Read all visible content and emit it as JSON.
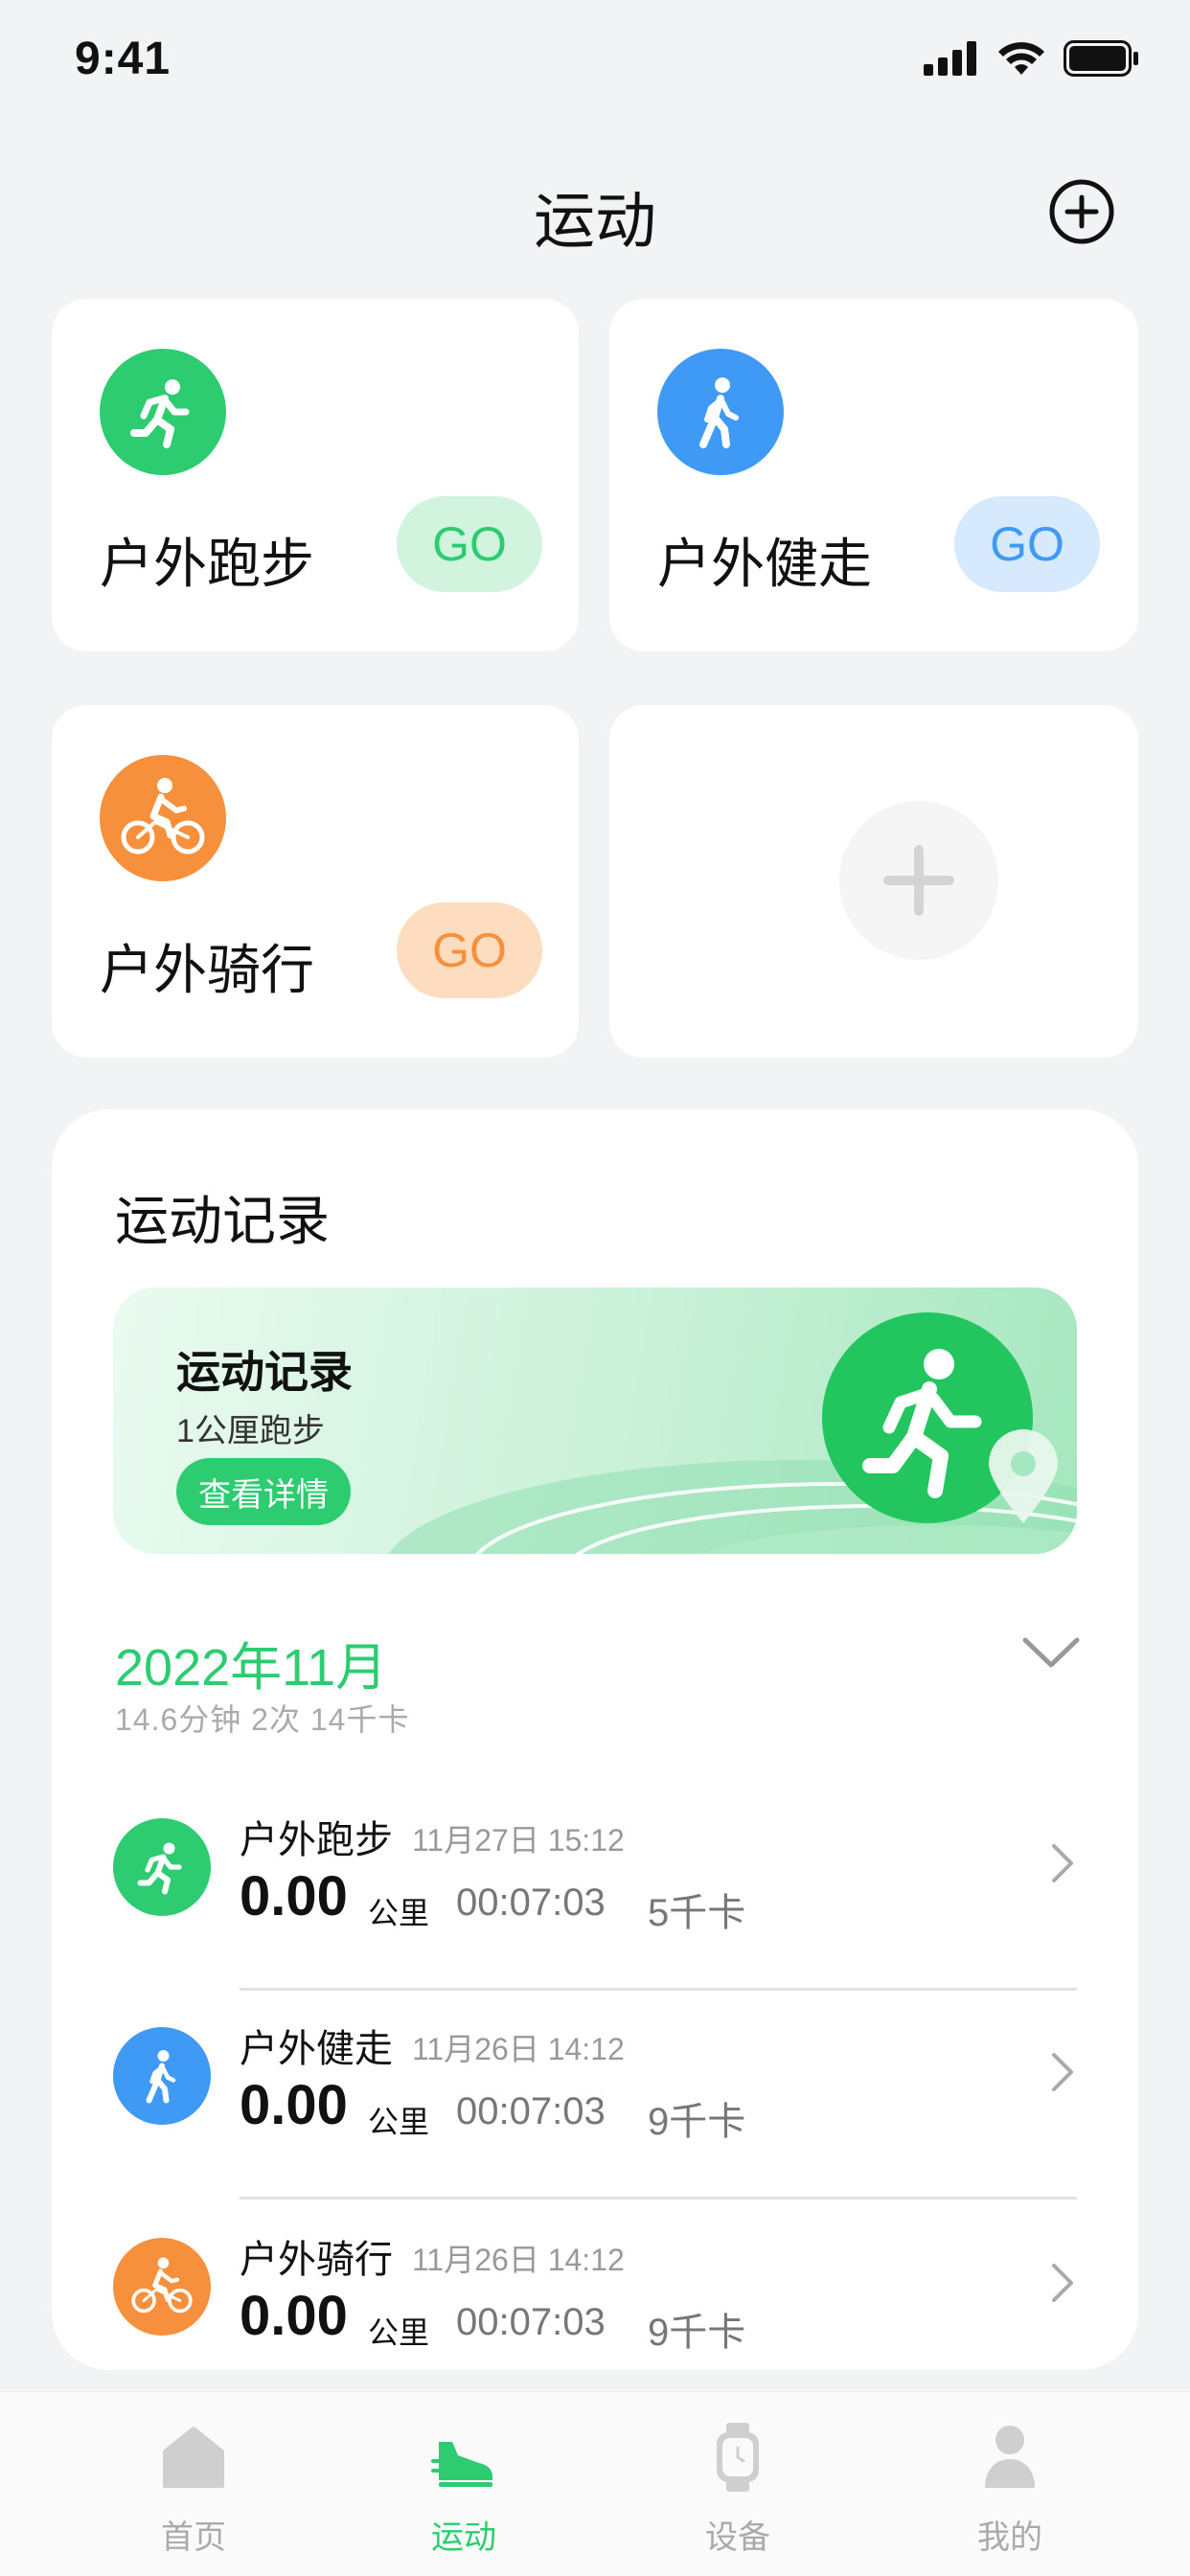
{
  "status_bar": {
    "time": "9:41"
  },
  "header": {
    "title": "运动"
  },
  "sport_cards": [
    {
      "label": "户外跑步",
      "go": "GO",
      "color": "#2ecc71",
      "go_bg": "#d2f4de",
      "icon": "run-icon"
    },
    {
      "label": "户外健走",
      "go": "GO",
      "color": "#3f9af5",
      "go_bg": "#d6e9fd",
      "icon": "walk-icon"
    },
    {
      "label": "户外骑行",
      "go": "GO",
      "color": "#f7903d",
      "go_bg": "#fddcc0",
      "icon": "bike-icon"
    }
  ],
  "records": {
    "title": "运动记录",
    "banner": {
      "title": "运动记录",
      "subtitle": "1公厘跑步",
      "button": "查看详情"
    },
    "month": {
      "title": "2022年11月",
      "summary": "14.6分钟  2次  14千卡"
    },
    "items": [
      {
        "name": "户外跑步",
        "time": "11月27日   15:12",
        "distance": "0.00",
        "unit": "公里",
        "duration": "00:07:03",
        "calories": "5千卡",
        "icon": "run-icon"
      },
      {
        "name": "户外健走",
        "time": "11月26日   14:12",
        "distance": "0.00",
        "unit": "公里",
        "duration": "00:07:03",
        "calories": "9千卡",
        "icon": "walk-icon"
      },
      {
        "name": "户外骑行",
        "time": "11月26日   14:12",
        "distance": "0.00",
        "unit": "公里",
        "duration": "00:07:03",
        "calories": "9千卡",
        "icon": "bike-icon"
      }
    ]
  },
  "tabbar": {
    "items": [
      {
        "label": "首页",
        "icon": "home-icon",
        "active": false
      },
      {
        "label": "运动",
        "icon": "shoe-icon",
        "active": true
      },
      {
        "label": "设备",
        "icon": "watch-icon",
        "active": false
      },
      {
        "label": "我的",
        "icon": "person-icon",
        "active": false
      }
    ],
    "active_color": "#2ecc71",
    "inactive_color": "#bdbdbd"
  }
}
